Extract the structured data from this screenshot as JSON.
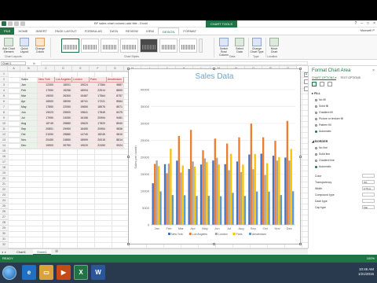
{
  "window": {
    "title": "BF sales chart column add title - Excel",
    "context_label": "CHART TOOLS",
    "controls": [
      "?",
      "–",
      "□",
      "×"
    ]
  },
  "tabs": [
    "FILE",
    "HOME",
    "INSERT",
    "PAGE LAYOUT",
    "FORMULAS",
    "DATA",
    "REVIEW",
    "VIEW",
    "DESIGN",
    "FORMAT"
  ],
  "active_tab": "DESIGN",
  "user": "Maxwell P",
  "ribbon": {
    "left_buttons": [
      "Add Chart Element",
      "Quick Layout",
      "Change Colors"
    ],
    "right_buttons": [
      "Switch Row/ Column",
      "Select Data",
      "Change Chart Type",
      "Move Chart"
    ],
    "groups": [
      "Chart Layouts",
      "Chart Styles",
      "Data",
      "Type",
      "Location"
    ]
  },
  "formula_bar": {
    "name_box": "Chart 1",
    "fx": "fx"
  },
  "sheet": {
    "columns": [
      "A",
      "B",
      "C",
      "D",
      "E",
      "F",
      "G",
      "H",
      "I",
      "J",
      "K",
      "L",
      "M",
      "N",
      "O",
      "P",
      "Q"
    ],
    "rows": [
      "1",
      "2",
      "3",
      "4",
      "5",
      "6",
      "7",
      "8",
      "9",
      "10",
      "11",
      "12",
      "13",
      "14",
      "15",
      "16",
      "17",
      "18",
      "19",
      "20",
      "21",
      "22",
      "23",
      "24",
      "25",
      "26",
      "27",
      "28",
      "29",
      "30",
      "31",
      "32"
    ],
    "table_header": [
      "Sales",
      "New York",
      "Los Angeles",
      "London",
      "Paris",
      "Amsterdam"
    ],
    "table_rows": [
      [
        "Jan",
        "12300",
        "18001",
        "19024",
        "17384",
        "9887"
      ],
      [
        "Feb",
        "17950",
        "15256",
        "18094",
        "22514",
        "8800"
      ],
      [
        "Mar",
        "19000",
        "26300",
        "15487",
        "17564",
        "8757"
      ],
      [
        "Apr",
        "16500",
        "28090",
        "18741",
        "17221",
        "8564"
      ],
      [
        "May",
        "17850",
        "22050",
        "19650",
        "18576",
        "8571"
      ],
      [
        "Jun",
        "19023",
        "25500",
        "19841",
        "17845",
        "8475"
      ],
      [
        "Jul",
        "17950",
        "24050",
        "16156",
        "20994",
        "9481"
      ],
      [
        "Aug",
        "18745",
        "25880",
        "15620",
        "17820",
        "8540"
      ],
      [
        "Sep",
        "20801",
        "29950",
        "16450",
        "20954",
        "9836"
      ],
      [
        "Oct",
        "21050",
        "25880",
        "14740",
        "18245",
        "9810"
      ],
      [
        "Nov",
        "20450",
        "24850",
        "18999",
        "20015",
        "8814"
      ],
      [
        "Dec",
        "19900",
        "30750",
        "19020",
        "22450",
        "9924"
      ]
    ]
  },
  "chart_data": {
    "type": "bar",
    "title": "Sales Data",
    "xlabel": "",
    "ylabel": "Sales per month",
    "categories": [
      "Jan",
      "Feb",
      "Mar",
      "Apr",
      "May",
      "Jun",
      "Jul",
      "Aug",
      "Sep",
      "Oct",
      "Nov",
      "Dec"
    ],
    "y_ticks": [
      "0",
      "5000",
      "10000",
      "15000",
      "20000",
      "25000",
      "30000",
      "35000",
      "40000"
    ],
    "ylim": [
      0,
      40000
    ],
    "stacked": false,
    "grid": true,
    "legend_position": "bottom",
    "series": [
      {
        "name": "New York",
        "color": "#4472c4",
        "values": [
          12300,
          17950,
          19000,
          16500,
          17850,
          19023,
          17950,
          18745,
          20801,
          21050,
          20450,
          19900
        ]
      },
      {
        "name": "Los Angeles",
        "color": "#ed7d31",
        "values": [
          18001,
          15256,
          26300,
          28090,
          22050,
          25500,
          24050,
          25880,
          29950,
          25880,
          24850,
          30750
        ]
      },
      {
        "name": "London",
        "color": "#a5a5a5",
        "values": [
          19024,
          18094,
          15487,
          18741,
          19650,
          19841,
          16156,
          15620,
          16450,
          14740,
          18999,
          19020
        ]
      },
      {
        "name": "Paris",
        "color": "#ffc000",
        "values": [
          17384,
          22514,
          17564,
          17221,
          18576,
          17845,
          20994,
          17820,
          20954,
          18245,
          20015,
          22450
        ]
      },
      {
        "name": "Amsterdam",
        "color": "#5b9bd5",
        "values": [
          9887,
          8800,
          8757,
          8564,
          8571,
          8475,
          9481,
          8540,
          9836,
          9810,
          8814,
          9924
        ]
      }
    ]
  },
  "sheet_tabs": [
    "Chart1",
    "Sheet1"
  ],
  "active_sheet": "Sheet1",
  "status": {
    "left": "READY",
    "right": "100%"
  },
  "pane": {
    "title": "Format Chart Area",
    "tabs": [
      "CHART OPTIONS ▾",
      "TEXT OPTIONS"
    ],
    "fill_section": "▸ FILL",
    "fill_options": [
      "No fill",
      "Solid fill",
      "Gradient fill",
      "Picture or texture fill",
      "Pattern fill",
      "Automatic"
    ],
    "fill_selected": 5,
    "border_section": "◢ BORDER",
    "border_options": [
      "No line",
      "Solid line",
      "Gradient line",
      "Automatic"
    ],
    "border_selected": 3,
    "fields": [
      {
        "label": "Color",
        "value": ""
      },
      {
        "label": "Transparency",
        "value": "0%"
      },
      {
        "label": "Width",
        "value": "0.75 pt"
      },
      {
        "label": "Compound type",
        "value": ""
      },
      {
        "label": "Dash type",
        "value": ""
      },
      {
        "label": "Cap type",
        "value": "Flat"
      }
    ]
  },
  "taskbar": {
    "time": "10:46 AM",
    "date": "1/21/2015"
  }
}
